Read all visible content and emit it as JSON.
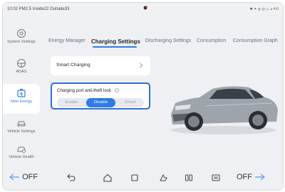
{
  "status": {
    "left_text": "10:02 PM2.5 Inside22 Outside33",
    "right_text": "✱ ✦ ◎ ◎ ◇ ⊿ 4:0"
  },
  "sidebar": {
    "items": [
      {
        "label": "System Settings",
        "icon": "gear-icon"
      },
      {
        "label": "ADAS",
        "icon": "steering-icon"
      },
      {
        "label": "New Energy",
        "icon": "battery-icon",
        "active": true
      },
      {
        "label": "Vehicle Settings",
        "icon": "car-icon"
      },
      {
        "label": "Vehicle Health",
        "icon": "car-health-icon"
      }
    ]
  },
  "tabs": [
    {
      "label": "Energy Manager"
    },
    {
      "label": "Charging  Settings",
      "active": true
    },
    {
      "label": "Discharging Settings"
    },
    {
      "label": "Consumption"
    },
    {
      "label": "Consumption Graph"
    }
  ],
  "smart_charging": {
    "label": "Smart Charging"
  },
  "lock": {
    "title": "Charging port anti-theft lock",
    "options": [
      "Enable",
      "Disable",
      "Smart"
    ],
    "selected": "Disable"
  },
  "bottom": {
    "left_temp": "OFF",
    "right_temp": "OFF"
  },
  "colors": {
    "accent": "#2f7be8",
    "highlight_border": "#2d6fd6"
  }
}
